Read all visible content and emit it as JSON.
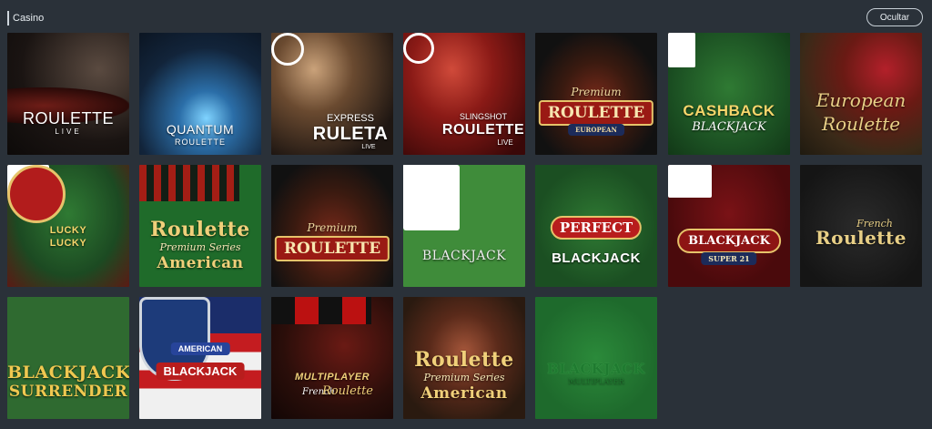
{
  "header": {
    "title": "Casino",
    "hide_label": "Ocultar"
  },
  "tiles": [
    {
      "line1": "ROULETTE",
      "line2": "LIVE"
    },
    {
      "line1": "QUANTUM",
      "line2": "ROULETTE"
    },
    {
      "line1": "EXPRESS",
      "line2": "RULETA",
      "line3": "LIVE"
    },
    {
      "line1": "SLINGSHOT",
      "line2": "ROULETTE",
      "line3": "LIVE"
    },
    {
      "line1": "Premium",
      "line2": "ROULETTE",
      "line3": "EUROPEAN"
    },
    {
      "line1": "CASHBACK",
      "line2": "BLACKJACK"
    },
    {
      "line1": "European",
      "line2": "Roulette"
    },
    {
      "line1": "LUCKY",
      "line2": "LUCKY"
    },
    {
      "line1": "Roulette",
      "line2": "Premium Series",
      "line3": "American"
    },
    {
      "line1": "Premium",
      "line2": "ROULETTE"
    },
    {
      "line1": "BLACKJACK"
    },
    {
      "line1": "PERFECT",
      "line2": "BLACKJACK"
    },
    {
      "line1": "BLACKJACK",
      "line2": "SUPER 21"
    },
    {
      "line1": "French",
      "line2": "Roulette"
    },
    {
      "line1": "BLACKJACK",
      "line2": "SURRENDER"
    },
    {
      "line1": "AMERICAN",
      "line2": "BLACKJACK"
    },
    {
      "line1": "MULTIPLAYER",
      "line2": "French",
      "line3": "Roulette"
    },
    {
      "line1": "Roulette",
      "line2": "Premium Series",
      "line3": "American"
    },
    {
      "line1": "BLACKJACK",
      "line2": "MULTIPLAYER"
    }
  ]
}
